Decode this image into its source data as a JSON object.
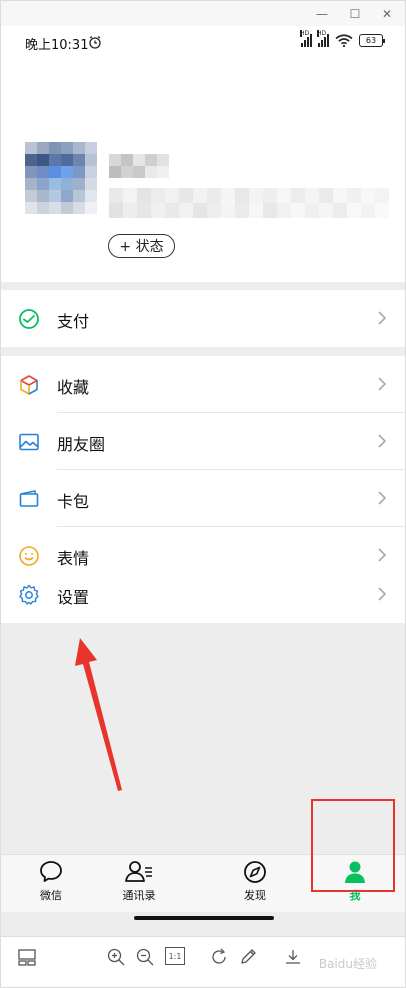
{
  "window": {
    "minimize_glyph": "—",
    "maximize_glyph": "☐",
    "close_glyph": "✕"
  },
  "status_bar": {
    "time": "晚上10:31",
    "battery": "63",
    "network_badge": "HD"
  },
  "profile": {
    "status_button_label": "+ 状态"
  },
  "menu": {
    "pay": "支付",
    "favorites": "收藏",
    "moments": "朋友圈",
    "cards": "卡包",
    "stickers": "表情",
    "settings": "设置"
  },
  "tabbar": {
    "chats": "微信",
    "contacts": "通讯录",
    "discover": "发现",
    "me": "我"
  },
  "toolbar": {
    "ratio_label": "1:1",
    "watermark": "Baidu经验"
  },
  "colors": {
    "accent_green": "#07c160",
    "annotation_red": "#e8342c"
  }
}
